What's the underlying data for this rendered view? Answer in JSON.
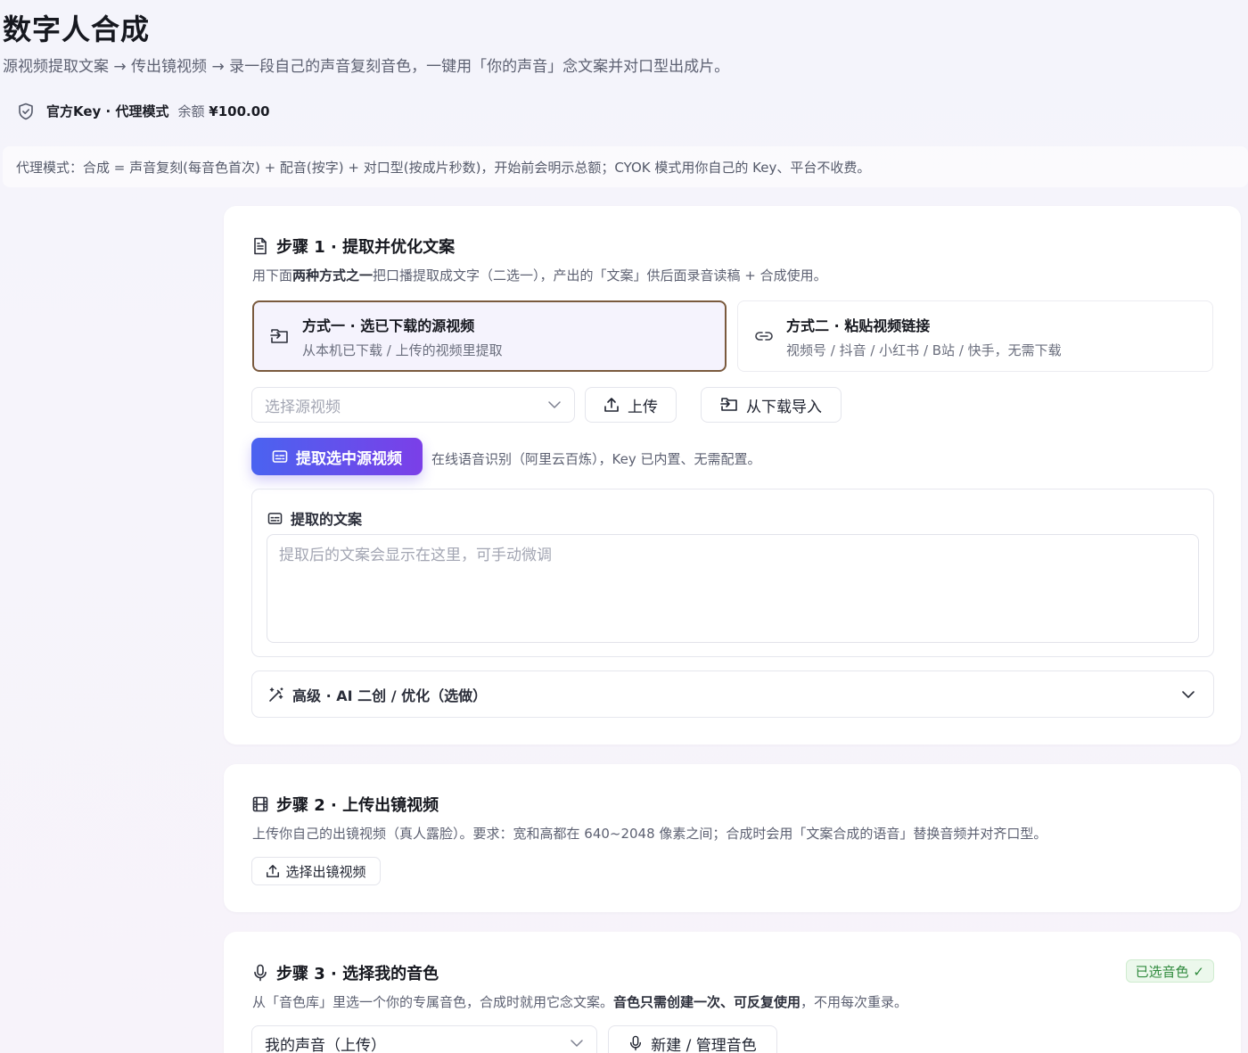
{
  "header": {
    "title": "数字人合成",
    "subtitle": "源视频提取文案 → 传出镜视频 → 录一段自己的声音复刻音色，一键用「你的声音」念文案并对口型出成片。",
    "mode_label": "官方Key · 代理模式",
    "balance_label": "余额",
    "balance_value": "¥100.00"
  },
  "notice": "代理模式：合成 = 声音复刻(每音色首次) + 配音(按字) + 对口型(按成片秒数)，开始前会明示总额；CYOK 模式用你自己的 Key、平台不收费。",
  "step1": {
    "title": "步骤 1 · 提取并优化文案",
    "desc_before": "用下面",
    "desc_bold": "两种方式之一",
    "desc_after": "把口播提取成文字（二选一），产出的「文案」供后面录音读稿 + 合成使用。",
    "method1_title": "方式一 · 选已下载的源视频",
    "method1_sub": "从本机已下载 / 上传的视频里提取",
    "method2_title": "方式二 · 粘贴视频链接",
    "method2_sub": "视频号 / 抖音 / 小红书 / B站 / 快手，无需下载",
    "select_placeholder": "选择源视频",
    "upload_label": "上传",
    "import_label": "从下载导入",
    "extract_label": "提取选中源视频",
    "extract_hint": "在线语音识别（阿里云百炼），Key 已内置、无需配置。",
    "panel_title": "提取的文案",
    "textarea_placeholder": "提取后的文案会显示在这里，可手动微调",
    "advanced_label": "高级 · AI 二创 / 优化（选做）"
  },
  "step2": {
    "title": "步骤 2 · 上传出镜视频",
    "desc": "上传你自己的出镜视频（真人露脸）。要求：宽和高都在 640~2048 像素之间；合成时会用「文案合成的语音」替换音频并对齐口型。",
    "choose_label": "选择出镜视频"
  },
  "step3": {
    "title": "步骤 3 · 选择我的音色",
    "badge": "已选音色 ✓",
    "desc_before": "从「音色库」里选一个你的专属音色，合成时就用它念文案。",
    "desc_bold": "音色只需创建一次、可反复使用",
    "desc_after": "，不用每次重录。",
    "voice_selected": "我的声音（上传）",
    "manage_label": "新建 / 管理音色"
  },
  "colors": {
    "accent_start": "#4a63f0",
    "accent_end": "#7b3fe8",
    "active_border": "#7a5a3e",
    "success": "#2f8a3d"
  }
}
